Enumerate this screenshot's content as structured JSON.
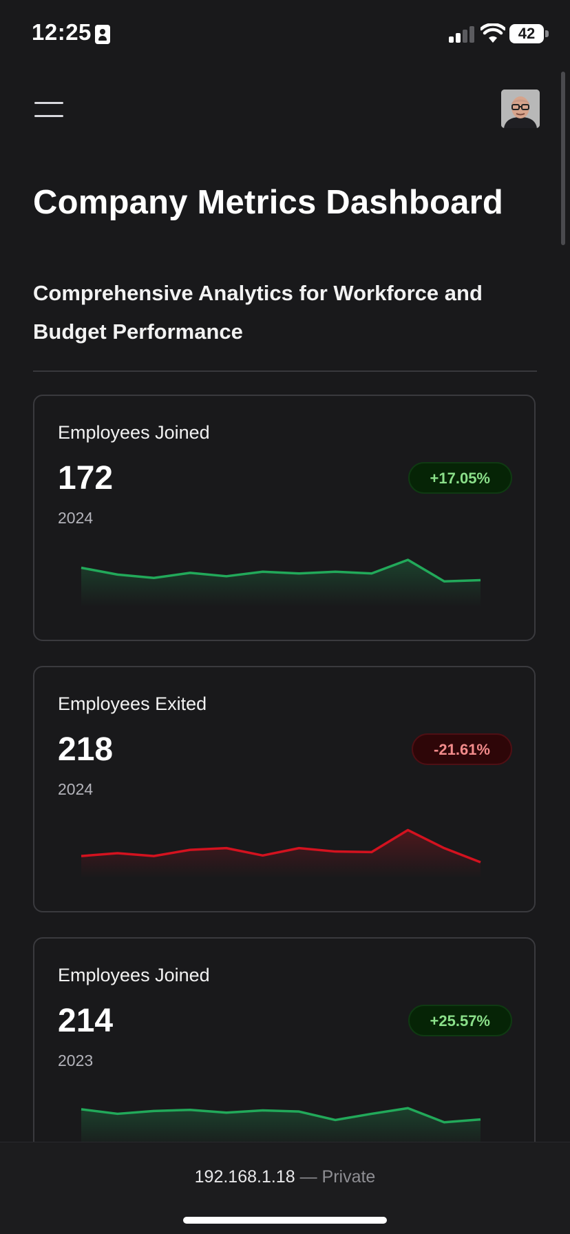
{
  "status_bar": {
    "time": "12:25",
    "battery": "42"
  },
  "header": {
    "title": "Company Metrics Dashboard",
    "subtitle": "Comprehensive Analytics for Workforce and Budget Performance"
  },
  "cards": [
    {
      "label": "Employees Joined",
      "value": "172",
      "year": "2024",
      "change": "+17.05%",
      "trend": "up",
      "color": "#22a95a",
      "series": [
        64,
        52,
        46,
        55,
        49,
        57,
        54,
        57,
        54,
        78,
        40,
        42
      ]
    },
    {
      "label": "Employees Exited",
      "value": "218",
      "year": "2024",
      "change": "-21.61%",
      "trend": "down",
      "color": "#d3121f",
      "series": [
        34,
        39,
        34,
        45,
        48,
        35,
        48,
        42,
        41,
        80,
        48,
        23
      ]
    },
    {
      "label": "Employees Joined",
      "value": "214",
      "year": "2023",
      "change": "+25.57%",
      "trend": "up",
      "color": "#22a95a",
      "series": [
        66,
        58,
        63,
        65,
        60,
        64,
        62,
        47,
        58,
        68,
        43,
        48
      ]
    }
  ],
  "browser": {
    "host": "192.168.1.18",
    "separator": "—",
    "mode": "Private"
  }
}
